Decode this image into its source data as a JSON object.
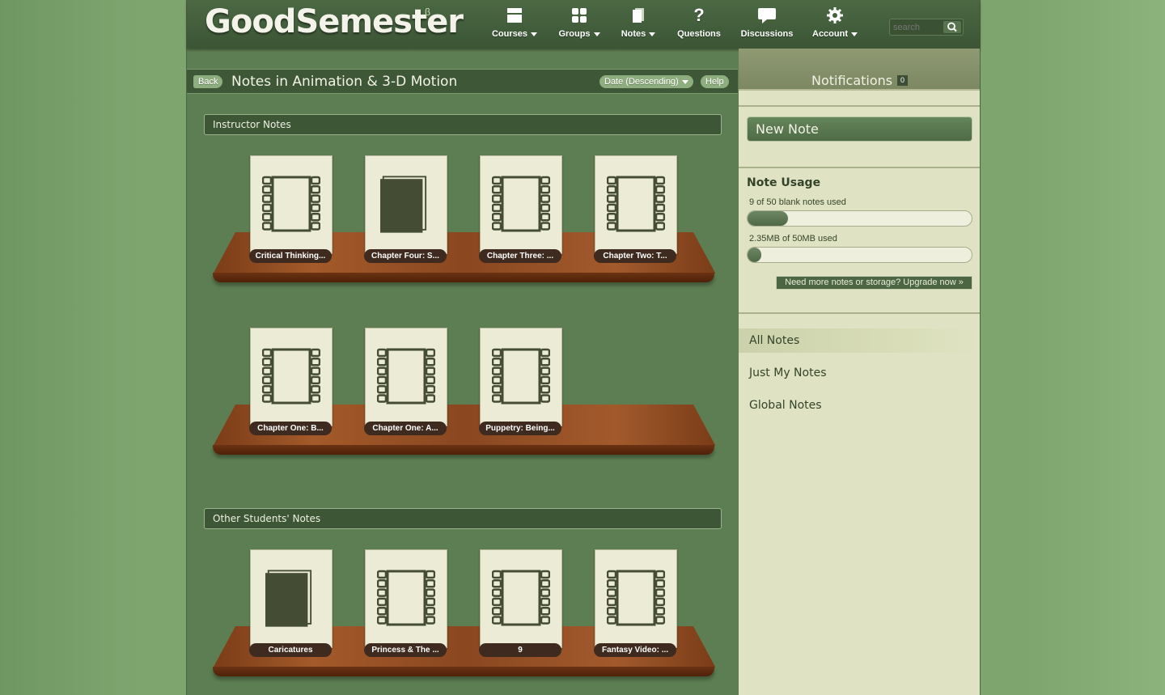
{
  "app": {
    "logo": "GoodSemester",
    "beta_mark": "β"
  },
  "nav": [
    {
      "label": "Courses",
      "icon": "courses-icon",
      "dropdown": true
    },
    {
      "label": "Groups",
      "icon": "groups-icon",
      "dropdown": true
    },
    {
      "label": "Notes",
      "icon": "notes-icon",
      "dropdown": true
    },
    {
      "label": "Questions",
      "icon": "question-icon",
      "dropdown": false
    },
    {
      "label": "Discussions",
      "icon": "discussions-icon",
      "dropdown": false
    },
    {
      "label": "Account",
      "icon": "gear-icon",
      "dropdown": true
    }
  ],
  "search": {
    "placeholder": "search"
  },
  "header": {
    "back_label": "Back",
    "title": "Notes in Animation & 3-D Motion",
    "sort_label": "Date (Descending)",
    "help_label": "Help"
  },
  "sections": [
    {
      "title": "Instructor Notes"
    },
    {
      "title": "Other Students' Notes"
    }
  ],
  "instructor_notes": [
    {
      "label": "Critical Thinking...",
      "type": "video"
    },
    {
      "label": "Chapter Four: S...",
      "type": "document"
    },
    {
      "label": "Chapter Three: ...",
      "type": "video"
    },
    {
      "label": "Chapter Two: T...",
      "type": "video"
    },
    {
      "label": "Chapter One: B...",
      "type": "video"
    },
    {
      "label": "Chapter One: A...",
      "type": "video"
    },
    {
      "label": "Puppetry: Being...",
      "type": "video"
    }
  ],
  "student_notes": [
    {
      "label": "Caricatures",
      "type": "document"
    },
    {
      "label": "Princess & The ...",
      "type": "video"
    },
    {
      "label": "9",
      "type": "video"
    },
    {
      "label": "Fantasy Video: ...",
      "type": "video"
    }
  ],
  "sidebar": {
    "notifications_label": "Notifications",
    "notifications_count": "0",
    "new_note_label": "New Note",
    "usage_title": "Note Usage",
    "blank_notes_text": "9 of 50 blank notes used",
    "blank_notes_fraction": 0.18,
    "storage_text": "2.35MB of 50MB used",
    "storage_fraction": 0.047,
    "upgrade_label": "Need more notes or storage? Upgrade now »",
    "filters": [
      "All Notes",
      "Just My Notes",
      "Global Notes"
    ],
    "active_filter": "All Notes"
  },
  "colors": {
    "accent": "#4e6b46",
    "background": "#7fa56f",
    "shelf": "#8a4720"
  }
}
